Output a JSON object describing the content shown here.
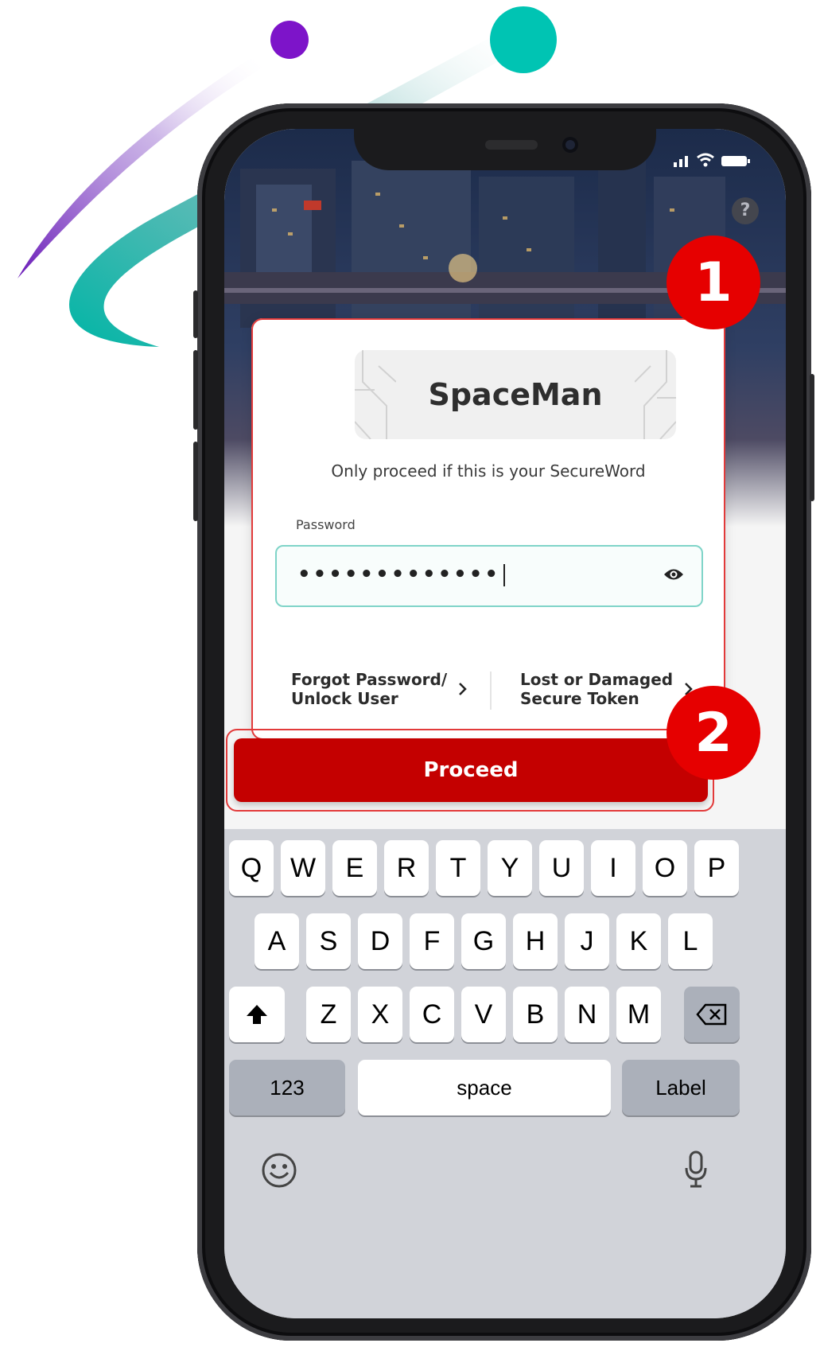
{
  "app": {
    "secure_word": "SpaceMan",
    "secure_word_hint": "Only proceed if this is your SecureWord",
    "password_label": "Password",
    "password_value": "•••••••••••••",
    "forgot_link": "Forgot Password/\nUnlock User",
    "lost_token_link": "Lost or Damaged\nSecure Token",
    "proceed_label": "Proceed",
    "help_icon": "?"
  },
  "annotations": {
    "badge_1": "1",
    "badge_2": "2"
  },
  "keyboard": {
    "row1": [
      "Q",
      "W",
      "E",
      "R",
      "T",
      "Y",
      "U",
      "I",
      "O",
      "P"
    ],
    "row2": [
      "A",
      "S",
      "D",
      "F",
      "G",
      "H",
      "J",
      "K",
      "L"
    ],
    "row3": [
      "Z",
      "X",
      "C",
      "V",
      "B",
      "N",
      "M"
    ],
    "numbers_key": "123",
    "space_key": "space",
    "return_key": "Label"
  },
  "colors": {
    "brand_red": "#c40000",
    "annotation_red": "#e60000",
    "input_border": "#7fd4c8",
    "accent_teal": "#00c4b3",
    "accent_purple": "#7a1fc9"
  },
  "icons": [
    "help-icon",
    "eye-icon",
    "chevron-right-icon",
    "shift-icon",
    "backspace-icon",
    "emoji-icon",
    "microphone-icon",
    "signal-icon",
    "wifi-icon",
    "battery-icon"
  ]
}
